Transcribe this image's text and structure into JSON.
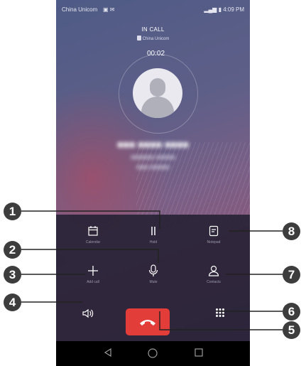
{
  "status": {
    "carrier": "China Unicom",
    "time": "4:09 PM"
  },
  "call": {
    "state": "IN CALL",
    "sim": "China Unicom",
    "timer": "00:02"
  },
  "controls": [
    {
      "label": "Calendar",
      "icon": "calendar-icon"
    },
    {
      "label": "Hold",
      "icon": "pause-icon"
    },
    {
      "label": "Notepad",
      "icon": "notepad-icon"
    },
    {
      "label": "Add call",
      "icon": "plus-icon"
    },
    {
      "label": "Mute",
      "icon": "microphone-icon"
    },
    {
      "label": "Contacts",
      "icon": "person-icon"
    }
  ],
  "callouts": [
    "1",
    "2",
    "3",
    "4",
    "5",
    "6",
    "7",
    "8"
  ],
  "colors": {
    "end_call": "#e33d3a",
    "callout": "#3d3d3d"
  }
}
